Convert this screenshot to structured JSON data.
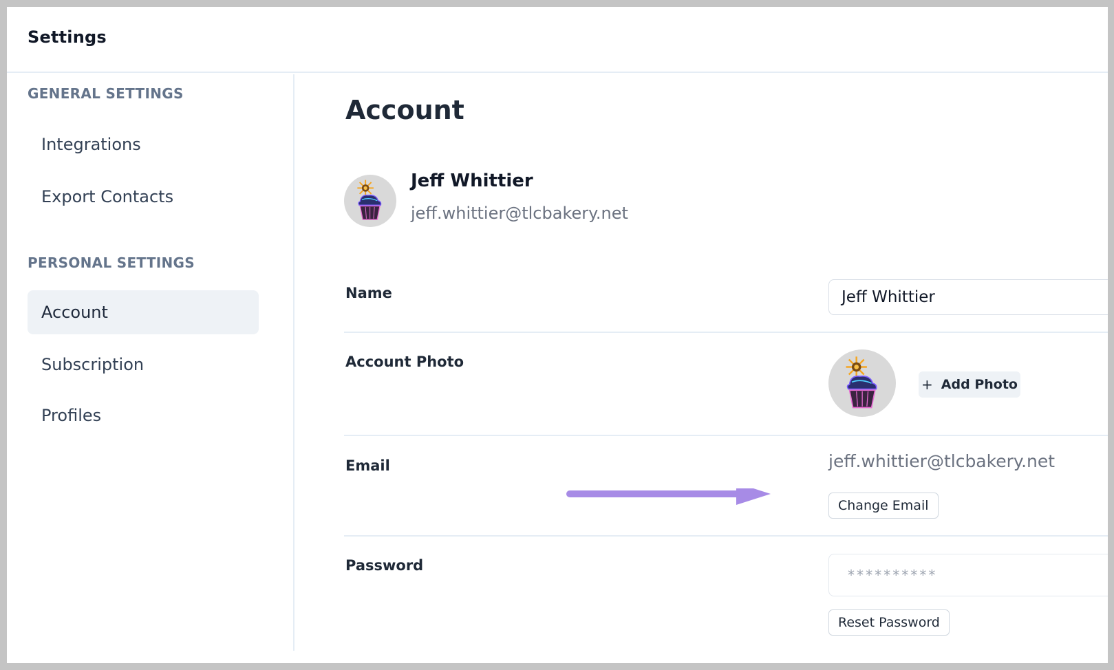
{
  "app": {
    "title": "Settings"
  },
  "sidebar": {
    "general_heading": "GENERAL SETTINGS",
    "general_items": [
      {
        "label": "Integrations"
      },
      {
        "label": "Export Contacts"
      }
    ],
    "personal_heading": "PERSONAL SETTINGS",
    "personal_items": [
      {
        "label": "Account",
        "active": true
      },
      {
        "label": "Subscription"
      },
      {
        "label": "Profiles"
      }
    ]
  },
  "main": {
    "title": "Account",
    "profile": {
      "name": "Jeff Whittier",
      "email": "jeff.whittier@tlcbakery.net",
      "avatar_icon": "cupcake-avatar"
    },
    "fields": {
      "name": {
        "label": "Name",
        "value": "Jeff Whittier"
      },
      "photo": {
        "label": "Account Photo",
        "add_label": "Add Photo",
        "add_icon": "plus-icon"
      },
      "email": {
        "label": "Email",
        "value": "jeff.whittier@tlcbakery.net",
        "button": "Change Email"
      },
      "password": {
        "label": "Password",
        "value": "**********",
        "button": "Reset Password"
      }
    }
  },
  "colors": {
    "accent_arrow": "#a78be6",
    "active_nav_bg": "#eef2f6",
    "section_heading": "#64748b"
  }
}
